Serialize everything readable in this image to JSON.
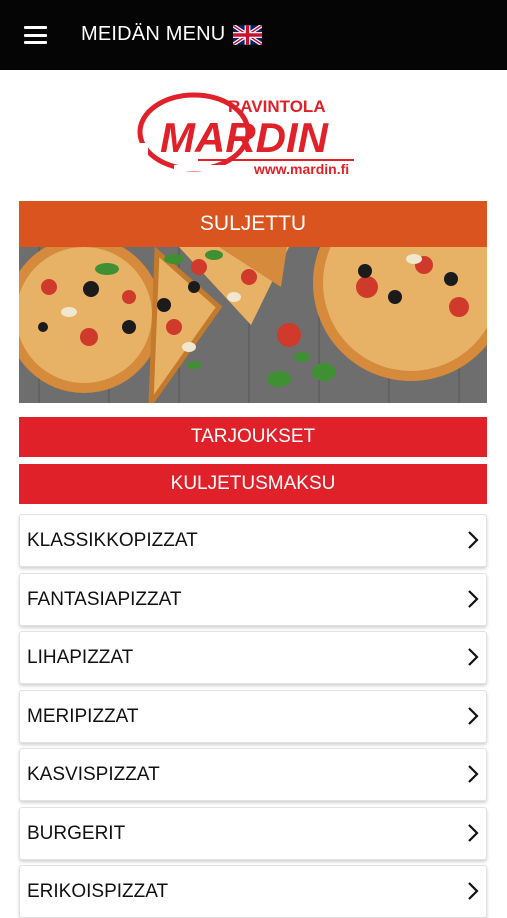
{
  "header": {
    "title": "MEIDÄN MENU"
  },
  "logo": {
    "top_text": "RAVINTOLA",
    "brand": "MARDIN",
    "url": "www.mardin.fi"
  },
  "status": {
    "label": "SULJETTU"
  },
  "buttons": {
    "offers": "TARJOUKSET",
    "delivery": "KULJETUSMAKSU"
  },
  "categories": [
    {
      "label": "KLASSIKKOPIZZAT"
    },
    {
      "label": "FANTASIAPIZZAT"
    },
    {
      "label": "LIHAPIZZAT"
    },
    {
      "label": "MERIPIZZAT"
    },
    {
      "label": "KASVISPIZZAT"
    },
    {
      "label": "BURGERIT"
    },
    {
      "label": "ERIKOISPIZZAT"
    }
  ],
  "icons": {
    "menu": "hamburger-icon",
    "language": "uk-flag-icon",
    "chevron": "chevron-right-icon"
  },
  "colors": {
    "topbar": "#050505",
    "status": "#d9541f",
    "accent": "#e0212a"
  }
}
